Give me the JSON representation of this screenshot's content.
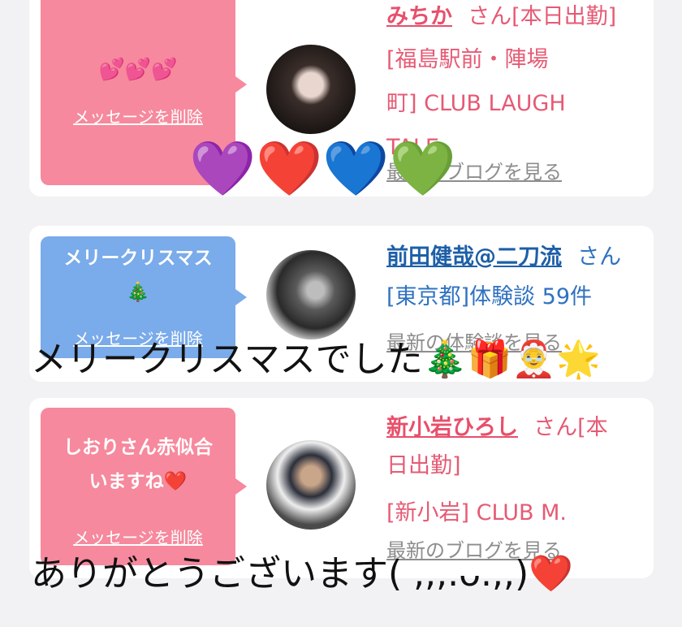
{
  "cards": [
    {
      "message": "💕💕💕",
      "delete_label": "メッセージを削除",
      "name": "みちか",
      "honorific": "さん[本日出勤]",
      "location_lines": [
        "[福島駅前・陣場",
        "町] CLUB LAUGH",
        "TALE"
      ],
      "more_label": "最新のブログを見る"
    },
    {
      "message_line1": "メリークリスマス",
      "message_line2": "🎄",
      "delete_label": "メッセージを削除",
      "name": "前田健哉@二刀流",
      "honorific": "さん",
      "detail": "[東京都]体験談 59件",
      "more_label": "最新の体験談を見る"
    },
    {
      "message_line1": "しおりさん赤似合",
      "message_line2": "いますね❤️",
      "delete_label": "メッセージを削除",
      "name": "新小岩ひろし",
      "honorific_line1": "さん[本",
      "honorific_line2": "日出勤]",
      "location": "[新小岩] CLUB M.",
      "more_label": "最新のブログを見る"
    }
  ],
  "overlay": {
    "hearts": [
      "💜",
      "❤️",
      "💙",
      "💚"
    ],
    "caption1": "メリークリスマスでした🎄🎁🤶🌟",
    "caption2": "ありがとうございます( ,,,.ᴗ.,,)❤️"
  }
}
